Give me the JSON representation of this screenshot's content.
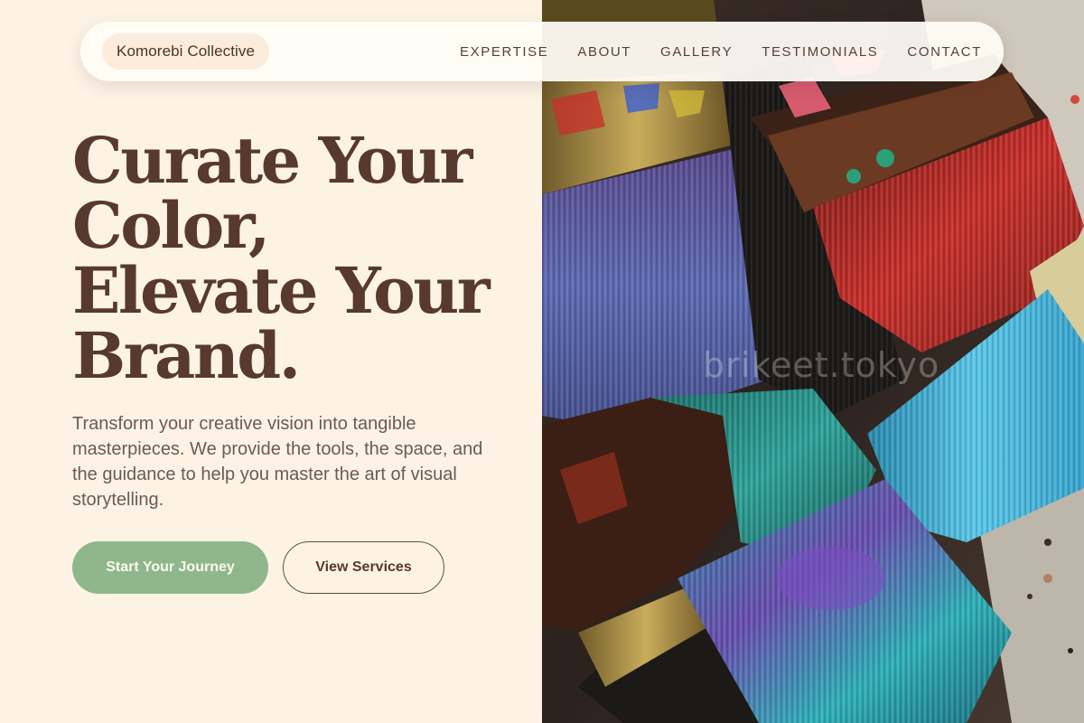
{
  "nav": {
    "brand": "Komorebi Collective",
    "links": [
      "EXPERTISE",
      "ABOUT",
      "GALLERY",
      "TESTIMONIALS",
      "CONTACT"
    ]
  },
  "hero": {
    "title_lines": [
      "Curate Your",
      "Color,",
      "Elevate Your",
      "Brand."
    ],
    "subtitle": "Transform your creative vision into tangible masterpieces. We provide the tools, the space, and the guidance to help you master the art of visual storytelling.",
    "primary_cta": "Start Your Journey",
    "secondary_cta": "View Services"
  },
  "image": {
    "subject": "paint-brushes-photo",
    "watermark": "brikeet.tokyo"
  },
  "colors": {
    "background": "#fdf3e5",
    "heading": "#58392d",
    "body_text": "#6d5a50",
    "primary_button": "#8fb78b",
    "nav_background": "#fffcf7"
  }
}
